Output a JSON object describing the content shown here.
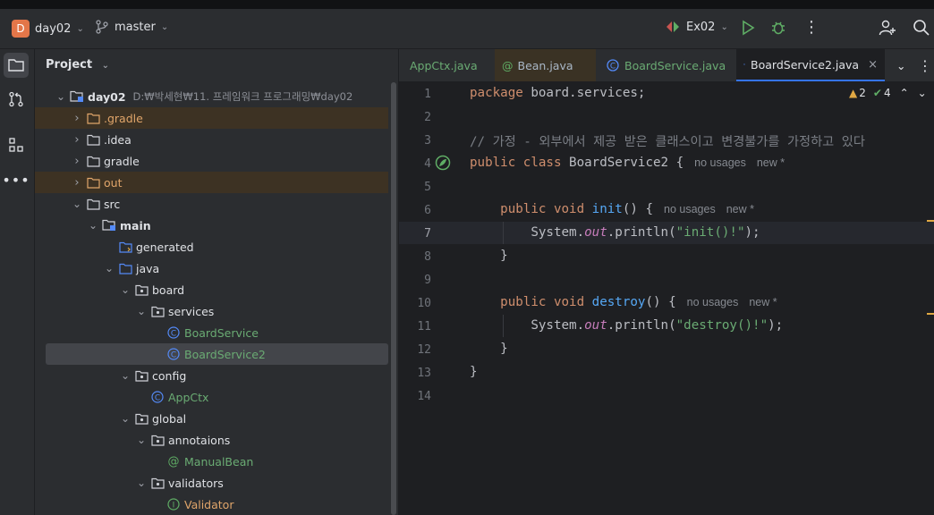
{
  "toolbar": {
    "project_badge": "D",
    "project_name": "day02",
    "branch": "master",
    "run_config": "Ex02"
  },
  "project_panel": {
    "title": "Project",
    "tree": [
      {
        "label": "day02",
        "path": "D:₩박세현₩11. 프레임워크 프로그래밍₩day02",
        "depth": 0,
        "expanded": true,
        "icon": "module-folder-icon",
        "bold": true,
        "color": "#dfe1e5"
      },
      {
        "label": ".gradle",
        "depth": 1,
        "expanded": false,
        "icon": "excluded-folder-icon",
        "excluded": true,
        "color": "#e0a56a"
      },
      {
        "label": ".idea",
        "depth": 1,
        "expanded": false,
        "icon": "folder-icon",
        "color": "#dfe1e5"
      },
      {
        "label": "gradle",
        "depth": 1,
        "expanded": false,
        "icon": "folder-icon",
        "color": "#dfe1e5"
      },
      {
        "label": "out",
        "depth": 1,
        "expanded": false,
        "icon": "excluded-folder-icon",
        "excluded": true,
        "color": "#e0a56a"
      },
      {
        "label": "src",
        "depth": 1,
        "expanded": true,
        "icon": "folder-icon",
        "color": "#dfe1e5"
      },
      {
        "label": "main",
        "depth": 2,
        "expanded": true,
        "icon": "module-folder-icon",
        "bold": true,
        "color": "#dfe1e5"
      },
      {
        "label": "generated",
        "depth": 3,
        "leaf": true,
        "icon": "generated-folder-icon",
        "color": "#dfe1e5"
      },
      {
        "label": "java",
        "depth": 3,
        "expanded": true,
        "icon": "source-folder-icon",
        "color": "#dfe1e5"
      },
      {
        "label": "board",
        "depth": 4,
        "expanded": true,
        "icon": "package-icon",
        "color": "#dfe1e5"
      },
      {
        "label": "services",
        "depth": 5,
        "expanded": true,
        "icon": "package-icon",
        "color": "#dfe1e5"
      },
      {
        "label": "BoardService",
        "depth": 6,
        "leaf": true,
        "icon": "class-icon",
        "color": "#6aab73"
      },
      {
        "label": "BoardService2",
        "depth": 6,
        "leaf": true,
        "icon": "class-icon",
        "selected": true,
        "color": "#6aab73"
      },
      {
        "label": "config",
        "depth": 4,
        "expanded": true,
        "icon": "package-icon",
        "color": "#dfe1e5"
      },
      {
        "label": "AppCtx",
        "depth": 5,
        "leaf": true,
        "icon": "class-icon",
        "color": "#6aab73"
      },
      {
        "label": "global",
        "depth": 4,
        "expanded": true,
        "icon": "package-icon",
        "color": "#dfe1e5"
      },
      {
        "label": "annotaions",
        "depth": 5,
        "expanded": true,
        "icon": "package-icon",
        "color": "#dfe1e5"
      },
      {
        "label": "ManualBean",
        "depth": 6,
        "leaf": true,
        "icon": "annotation-icon",
        "color": "#6aab73"
      },
      {
        "label": "validators",
        "depth": 5,
        "expanded": true,
        "icon": "package-icon",
        "color": "#dfe1e5"
      },
      {
        "label": "Validator",
        "depth": 6,
        "leaf": true,
        "icon": "interface-icon",
        "color": "#e0a56a"
      }
    ]
  },
  "tabs": [
    {
      "label": "AppCtx.java",
      "icon": "class-icon",
      "color": "#6aab73"
    },
    {
      "label": "Bean.java",
      "icon": "annotation-icon",
      "color": "#dfe1e5"
    },
    {
      "label": "BoardService.java",
      "icon": "class-icon",
      "color": "#6aab73"
    },
    {
      "label": "BoardService2.java",
      "icon": "class-icon",
      "color": "#dfe1e5",
      "active": true
    }
  ],
  "inspections": {
    "warnings": "2",
    "ok": "4"
  },
  "code": {
    "line_numbers": [
      "1",
      "2",
      "3",
      "4",
      "5",
      "6",
      "7",
      "8",
      "9",
      "10",
      "11",
      "12",
      "13",
      "14"
    ],
    "current_line": "7",
    "l1_kw": "package",
    "l1_rest": " board.services;",
    "l3_comment": "// 가정 - 외부에서 제공 받은 클래스이고 변경불가를 가정하고 있다",
    "l4_kw": "public class",
    "l4_rest": " BoardService2 {",
    "l4_hint1": "no usages",
    "l4_hint2": "new *",
    "l6_kw": "public void",
    "l6_fn": " init",
    "l6_rest": "() {",
    "l6_hint1": "no usages",
    "l6_hint2": "new *",
    "l7_a": "System.",
    "l7_static": "out",
    "l7_b": ".println(",
    "l7_str": "\"init()!\"",
    "l7_c": ");",
    "l8": "}",
    "l10_kw": "public void",
    "l10_fn": " destroy",
    "l10_rest": "() {",
    "l10_hint1": "no usages",
    "l10_hint2": "new *",
    "l11_a": "System.",
    "l11_static": "out",
    "l11_b": ".println(",
    "l11_str": "\"destroy()!\"",
    "l11_c": ");",
    "l12": "}",
    "l13": "}"
  }
}
